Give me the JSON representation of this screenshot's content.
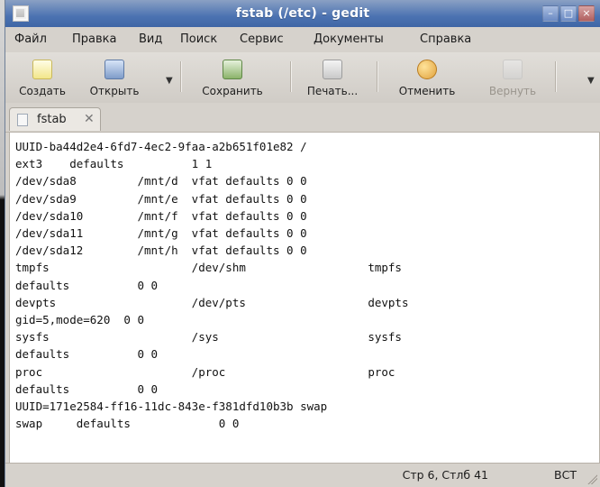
{
  "window": {
    "title": "fstab (/etc) - gedit"
  },
  "menu": [
    "Файл",
    "Правка",
    "Вид",
    "Поиск",
    "Сервис",
    "Документы",
    "Справка"
  ],
  "toolbar": {
    "new_label": "Создать",
    "open_label": "Открыть",
    "save_label": "Сохранить",
    "print_label": "Печать...",
    "undo_label": "Отменить",
    "redo_label": "Вернуть"
  },
  "tab": {
    "label": "fstab"
  },
  "editor": {
    "lines": [
      "UUID-ba44d2e4-6fd7-4ec2-9faa-a2b651f01e82 /",
      "ext3    defaults          1 1",
      "/dev/sda8         /mnt/d  vfat defaults 0 0",
      "/dev/sda9         /mnt/e  vfat defaults 0 0",
      "/dev/sda10        /mnt/f  vfat defaults 0 0",
      "/dev/sda11        /mnt/g  vfat defaults 0 0",
      "/dev/sda12        /mnt/h  vfat defaults 0 0",
      "tmpfs                     /dev/shm                  tmpfs",
      "defaults          0 0",
      "devpts                    /dev/pts                  devpts",
      "gid=5,mode=620  0 0",
      "sysfs                     /sys                      sysfs",
      "defaults          0 0",
      "proc                      /proc                     proc",
      "defaults          0 0",
      "UUID=171e2584-ff16-11dc-843e-f381dfd10b3b swap",
      "swap     defaults             0 0"
    ]
  },
  "status": {
    "position": "Стр 6, Стлб 41",
    "mode": "ВСТ"
  },
  "icons": {
    "app": "app-icon",
    "new": "new-document-icon",
    "open": "open-folder-icon",
    "save": "save-icon",
    "print": "printer-icon",
    "undo": "undo-icon",
    "redo": "redo-icon",
    "tab": "text-file-icon",
    "close": "close-icon"
  }
}
